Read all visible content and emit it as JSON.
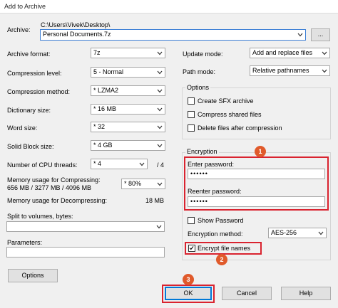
{
  "window": {
    "title": "Add to Archive"
  },
  "archive": {
    "label": "Archive:",
    "path": "C:\\Users\\Vivek\\Desktop\\",
    "name": "Personal Documents.7z",
    "browse_label": "..."
  },
  "left": {
    "archive_format": {
      "label": "Archive format:",
      "value": "7z"
    },
    "compression_level": {
      "label": "Compression level:",
      "value": "5 - Normal"
    },
    "compression_method": {
      "label": "Compression method:",
      "value": "* LZMA2"
    },
    "dictionary_size": {
      "label": "Dictionary size:",
      "value": "* 16 MB"
    },
    "word_size": {
      "label": "Word size:",
      "value": "* 32"
    },
    "solid_block_size": {
      "label": "Solid Block size:",
      "value": "* 4 GB"
    },
    "cpu_threads": {
      "label": "Number of CPU threads:",
      "value": "* 4",
      "max": "/ 4"
    },
    "memory_compress": {
      "label": "Memory usage for Compressing:",
      "detail": "656 MB / 3277 MB / 4096 MB",
      "value": "* 80%"
    },
    "memory_decompress": {
      "label": "Memory usage for Decompressing:",
      "value": "18 MB"
    },
    "split": {
      "label": "Split to volumes, bytes:",
      "value": ""
    },
    "parameters": {
      "label": "Parameters:",
      "value": ""
    },
    "options_button": "Options"
  },
  "right": {
    "update_mode": {
      "label": "Update mode:",
      "value": "Add and replace files"
    },
    "path_mode": {
      "label": "Path mode:",
      "value": "Relative pathnames"
    },
    "options": {
      "title": "Options",
      "sfx": "Create SFX archive",
      "compress_shared": "Compress shared files",
      "delete_after": "Delete files after compression"
    },
    "encryption": {
      "title": "Encryption",
      "enter_label": "Enter password:",
      "enter_value": "••••••",
      "reenter_label": "Reenter password:",
      "reenter_value": "••••••",
      "show_password": "Show Password",
      "method_label": "Encryption method:",
      "method_value": "AES-256",
      "encrypt_names": "Encrypt file names"
    }
  },
  "buttons": {
    "ok": "OK",
    "cancel": "Cancel",
    "help": "Help"
  },
  "badges": {
    "one": "1",
    "two": "2",
    "three": "3"
  },
  "colors": {
    "highlight_red": "#d9232f",
    "badge_orange": "#e05a2b",
    "focus_blue": "#0078d7"
  }
}
